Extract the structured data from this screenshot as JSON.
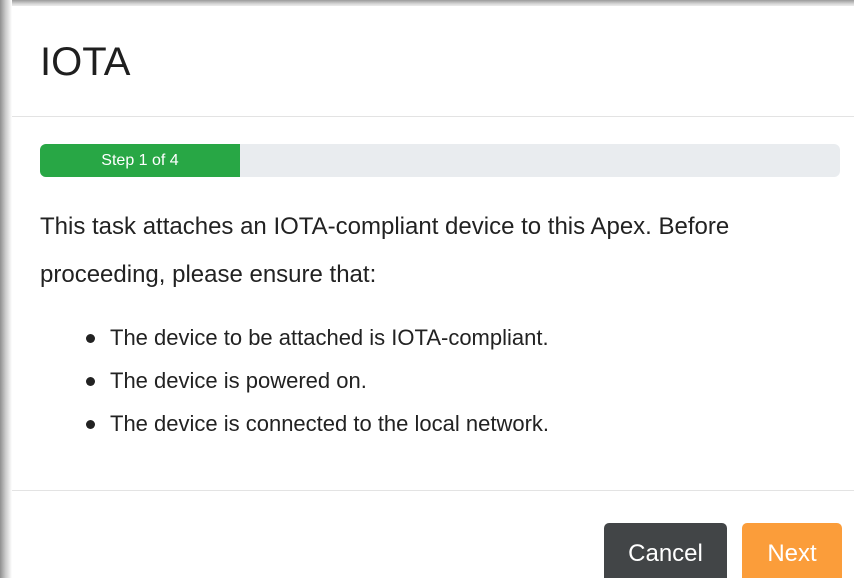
{
  "modal": {
    "title": "IOTA"
  },
  "progress": {
    "label": "Step 1 of 4",
    "current_step": 1,
    "total_steps": 4,
    "fraction": 0.25,
    "bar_color": "#28a745",
    "track_color": "#e9ecef"
  },
  "body": {
    "intro": "This task attaches an IOTA-compliant device to this Apex. Before proceeding, please ensure that:",
    "requirements": [
      "The device to be attached is IOTA-compliant.",
      "The device is powered on.",
      "The device is connected to the local network."
    ]
  },
  "footer": {
    "cancel_label": "Cancel",
    "next_label": "Next",
    "cancel_color": "#424547",
    "next_color": "#fb9d3a"
  }
}
